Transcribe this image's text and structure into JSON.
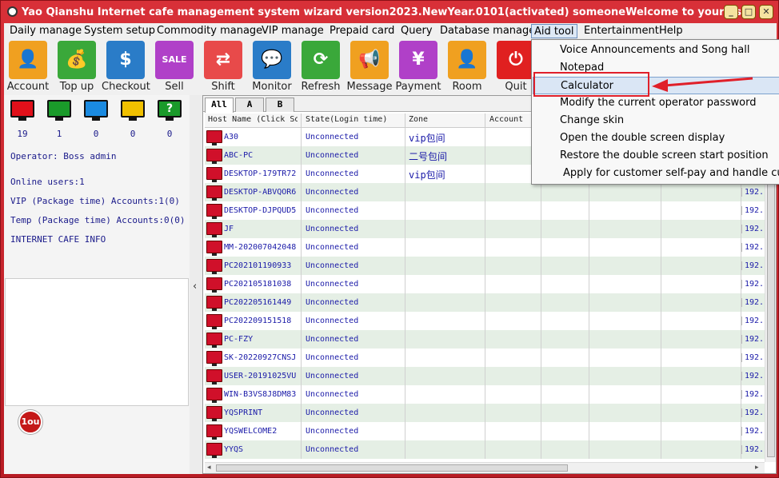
{
  "title": "Yao Qianshu Internet cafe management system wizard version2023.NewYear.0101(activated)  someoneWelcome to your use",
  "window_controls": [
    "_",
    "□",
    "✕"
  ],
  "menu": [
    "Daily manage",
    "System setup",
    "Commodity manage",
    "VIP manage",
    "Prepaid card",
    "Query",
    "Database manage",
    "Aid tool",
    "Entertainment",
    "Help"
  ],
  "toolbar": [
    {
      "label": "Account",
      "color": "#f0a020",
      "glyph": "👤"
    },
    {
      "label": "Top up",
      "color": "#3aa83a",
      "glyph": "💰"
    },
    {
      "label": "Checkout",
      "color": "#2a7cc8",
      "glyph": "$"
    },
    {
      "label": "Sell",
      "color": "#b040c8",
      "glyph": "SALE"
    },
    {
      "label": "Shift",
      "color": "#e84a4a",
      "glyph": "⇄"
    },
    {
      "label": "Monitor",
      "color": "#2a7cc8",
      "glyph": "💬"
    },
    {
      "label": "Refresh",
      "color": "#3aa83a",
      "glyph": "⟳"
    },
    {
      "label": "Message",
      "color": "#f0a020",
      "glyph": "📢"
    },
    {
      "label": "Payment",
      "color": "#b040c8",
      "glyph": "¥"
    },
    {
      "label": "Room",
      "color": "#f0a020",
      "glyph": "👤"
    },
    {
      "label": "Quit",
      "color": "#e02020",
      "glyph": "⏻"
    }
  ],
  "status_monitors": [
    {
      "color": "#e0101a",
      "count": "19"
    },
    {
      "color": "#1a9a2a",
      "count": "1"
    },
    {
      "color": "#1a8ae0",
      "count": "0"
    },
    {
      "color": "#f0c000",
      "count": "0"
    },
    {
      "color": "#1a9a2a",
      "count": "0",
      "glyph": "?"
    }
  ],
  "left_info": {
    "operator": "Operator: Boss admin",
    "online": "Online users:1",
    "vip": "VIP (Package time) Accounts:1(0)",
    "temp": "Temp (Package time) Accounts:0(0)",
    "cafe": "INTERNET CAFE  INFO",
    "logo": "1ou"
  },
  "tabs": [
    "All",
    "A",
    "B"
  ],
  "columns": [
    "Host Name (Click Sort)",
    "State(Login time)",
    "Zone",
    "Account"
  ],
  "rows": [
    {
      "host": "A30",
      "state": "Unconnected",
      "zone": "vip包间"
    },
    {
      "host": "ABC-PC",
      "state": "Unconnected",
      "zone": "二号包间"
    },
    {
      "host": "DESKTOP-179TR72",
      "state": "Unconnected",
      "zone": "vip包间"
    },
    {
      "host": "DESKTOP-ABVQOR6",
      "state": "Unconnected",
      "zone": "",
      "ip": "192."
    },
    {
      "host": "DESKTOP-DJPQUD5",
      "state": "Unconnected",
      "zone": "",
      "ip": "192."
    },
    {
      "host": "JF",
      "state": "Unconnected",
      "zone": "",
      "ip": "192."
    },
    {
      "host": "MM-202007042048",
      "state": "Unconnected",
      "zone": "",
      "ip": "192."
    },
    {
      "host": "PC202101190933",
      "state": "Unconnected",
      "zone": "",
      "ip": "192."
    },
    {
      "host": "PC202105181038",
      "state": "Unconnected",
      "zone": "",
      "ip": "192."
    },
    {
      "host": "PC202205161449",
      "state": "Unconnected",
      "zone": "",
      "ip": "192."
    },
    {
      "host": "PC202209151518",
      "state": "Unconnected",
      "zone": "",
      "ip": "192."
    },
    {
      "host": "PC-FZY",
      "state": "Unconnected",
      "zone": "",
      "ip": "192."
    },
    {
      "host": "SK-20220927CNSJ",
      "state": "Unconnected",
      "zone": "",
      "ip": "192."
    },
    {
      "host": "USER-20191025VU",
      "state": "Unconnected",
      "zone": "",
      "ip": "192."
    },
    {
      "host": "WIN-B3VS8J8DM83",
      "state": "Unconnected",
      "zone": "",
      "ip": "192."
    },
    {
      "host": "YQSPRINT",
      "state": "Unconnected",
      "zone": "",
      "ip": "192."
    },
    {
      "host": "YQSWELCOME2",
      "state": "Unconnected",
      "zone": "",
      "ip": "192."
    },
    {
      "host": "YYQS",
      "state": "Unconnected",
      "zone": "",
      "ip": "192."
    }
  ],
  "dropdown": [
    "Voice Announcements and Song hall",
    "Notepad",
    "Calculator",
    "Modify the current operator password",
    "Change skin",
    "Open the double screen display",
    "Restore the double screen start position",
    "Apply for customer self-pay and handle custom"
  ],
  "colors": {
    "highlight_box": "#e0202a",
    "frame": "#c4222a"
  }
}
